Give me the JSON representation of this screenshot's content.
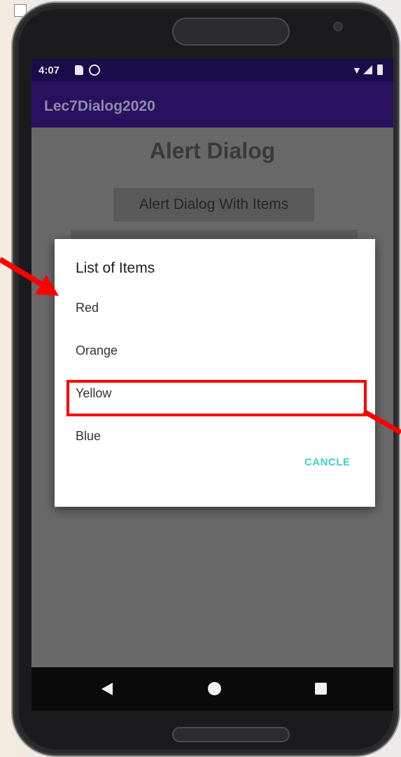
{
  "status_bar": {
    "time": "4:07"
  },
  "app_bar": {
    "title": "Lec7Dialog2020"
  },
  "content": {
    "title": "Alert Dialog",
    "button_items_label": "Alert Dialog With Items"
  },
  "dialog": {
    "title": "List of Items",
    "items": [
      "Red",
      "Orange",
      "Yellow",
      "Blue"
    ],
    "cancel_label": "CANCLE",
    "highlighted_item": "Yellow"
  },
  "colors": {
    "status_bar": "#1a0b4b",
    "app_bar": "#2a1160",
    "dialog_accent": "#3fd0c9",
    "annotation": "#ff0000"
  },
  "icons": {
    "status": [
      "sd-card-icon",
      "sync-icon",
      "wifi-icon",
      "signal-icon",
      "battery-icon"
    ],
    "nav": [
      "back-icon",
      "home-icon",
      "recents-icon"
    ]
  }
}
